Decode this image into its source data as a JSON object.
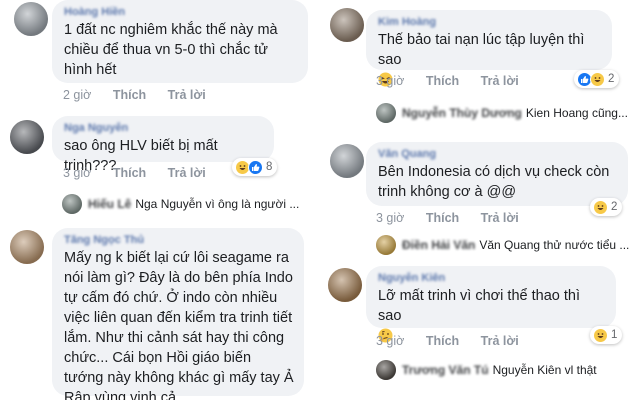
{
  "left_comments": [
    {
      "author": "Hoàng Hiền",
      "text": "1 đất nc nghiêm khắc thế này mà chiều để thua vn 5-0 thì chắc tử hình hết",
      "time": "2 giờ",
      "like": "Thích",
      "reply": "Trả lời"
    },
    {
      "author": "Nga Nguyễn",
      "text": "sao ông HLV biết bị mất trinh???",
      "time": "3 giờ",
      "like": "Thích",
      "reply": "Trả lời",
      "reaction_count": "8",
      "reply_preview": {
        "author": "Hiếu Lê",
        "text": "Nga Nguyễn vì ông là người ..."
      }
    },
    {
      "author": "Tăng Ngọc Thủ",
      "text": "Mấy ng k biết lại cứ lôi seagame ra nói làm gì? Đây là do bên phía Indo tự cấm đó chứ. Ở indo còn nhiều việc liên quan đến kiểm tra trinh tiết lắm. Như thi cảnh sát hay thi công chức... Cái bọn Hồi giáo biến tướng này không khác gì mấy tay Ả Rập vùng vịnh cả."
    }
  ],
  "right_comments": [
    {
      "author": "Kim Hoàng",
      "text": "Thế bảo tai nạn lúc tập luyện thì sao",
      "time": "3 giờ",
      "like": "Thích",
      "reply": "Trả lời",
      "reaction_count": "2",
      "reply_preview": {
        "author": "Nguyễn Thùy Dương",
        "text": "Kien Hoang cũng..."
      }
    },
    {
      "author": "Văn Quang",
      "text": "Bên Indonesia có dịch vụ check còn trinh không cơ à @@",
      "time": "3 giờ",
      "like": "Thích",
      "reply": "Trả lời",
      "reaction_count": "2",
      "reply_preview": {
        "author": "Điền Hải Văn",
        "text": "Văn Quang thử nước tiểu ..."
      }
    },
    {
      "author": "Nguyễn Kiên",
      "text": "Lỡ mất trinh vì chơi thể thao thì sao",
      "time": "3 giờ",
      "like": "Thích",
      "reply": "Trả lời",
      "reaction_count": "1",
      "reply_preview": {
        "author": "Trương Văn Tú",
        "text": "Nguyễn Kiên vl thật"
      }
    }
  ],
  "icons": {
    "haha": "haha-reaction-icon",
    "like": "like-reaction-icon",
    "thinking": "thinking-emoji-icon",
    "laughing": "laughing-emoji-icon"
  },
  "colors": {
    "bubble": "#f0f2f5",
    "link": "#365899",
    "muted": "#8d949e",
    "like_blue": "#1877f2",
    "haha_yellow": "#f7c948"
  }
}
